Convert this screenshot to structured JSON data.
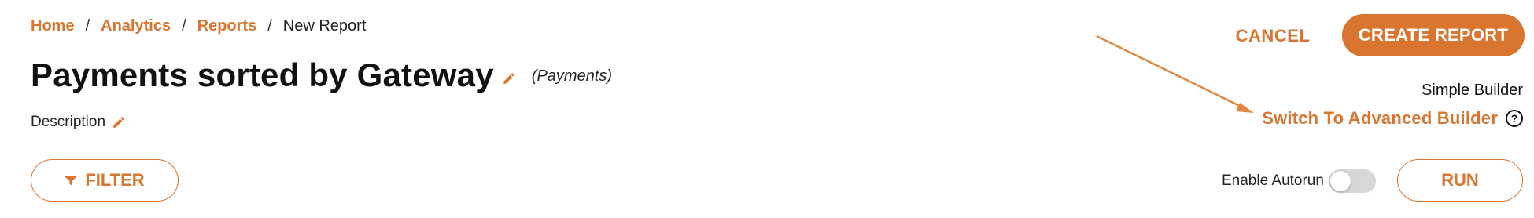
{
  "breadcrumb": {
    "items": [
      "Home",
      "Analytics",
      "Reports"
    ],
    "current": "New Report",
    "separator": "/"
  },
  "header": {
    "title": "Payments sorted by Gateway",
    "tag": "(Payments)",
    "description_label": "Description"
  },
  "toolbar": {
    "filter_label": "FILTER",
    "cancel_label": "CANCEL",
    "create_label": "CREATE REPORT",
    "run_label": "RUN"
  },
  "builder": {
    "mode_label": "Simple Builder",
    "switch_label": "Switch To Advanced Builder",
    "help_glyph": "?"
  },
  "autorun": {
    "label": "Enable Autorun",
    "enabled": false
  },
  "icons": {
    "edit": "pencil-icon",
    "filter": "funnel-icon",
    "help": "question-circle-icon"
  },
  "colors": {
    "accent": "#d9752e",
    "text": "#111111",
    "toggle_off": "#d7d7d7"
  }
}
